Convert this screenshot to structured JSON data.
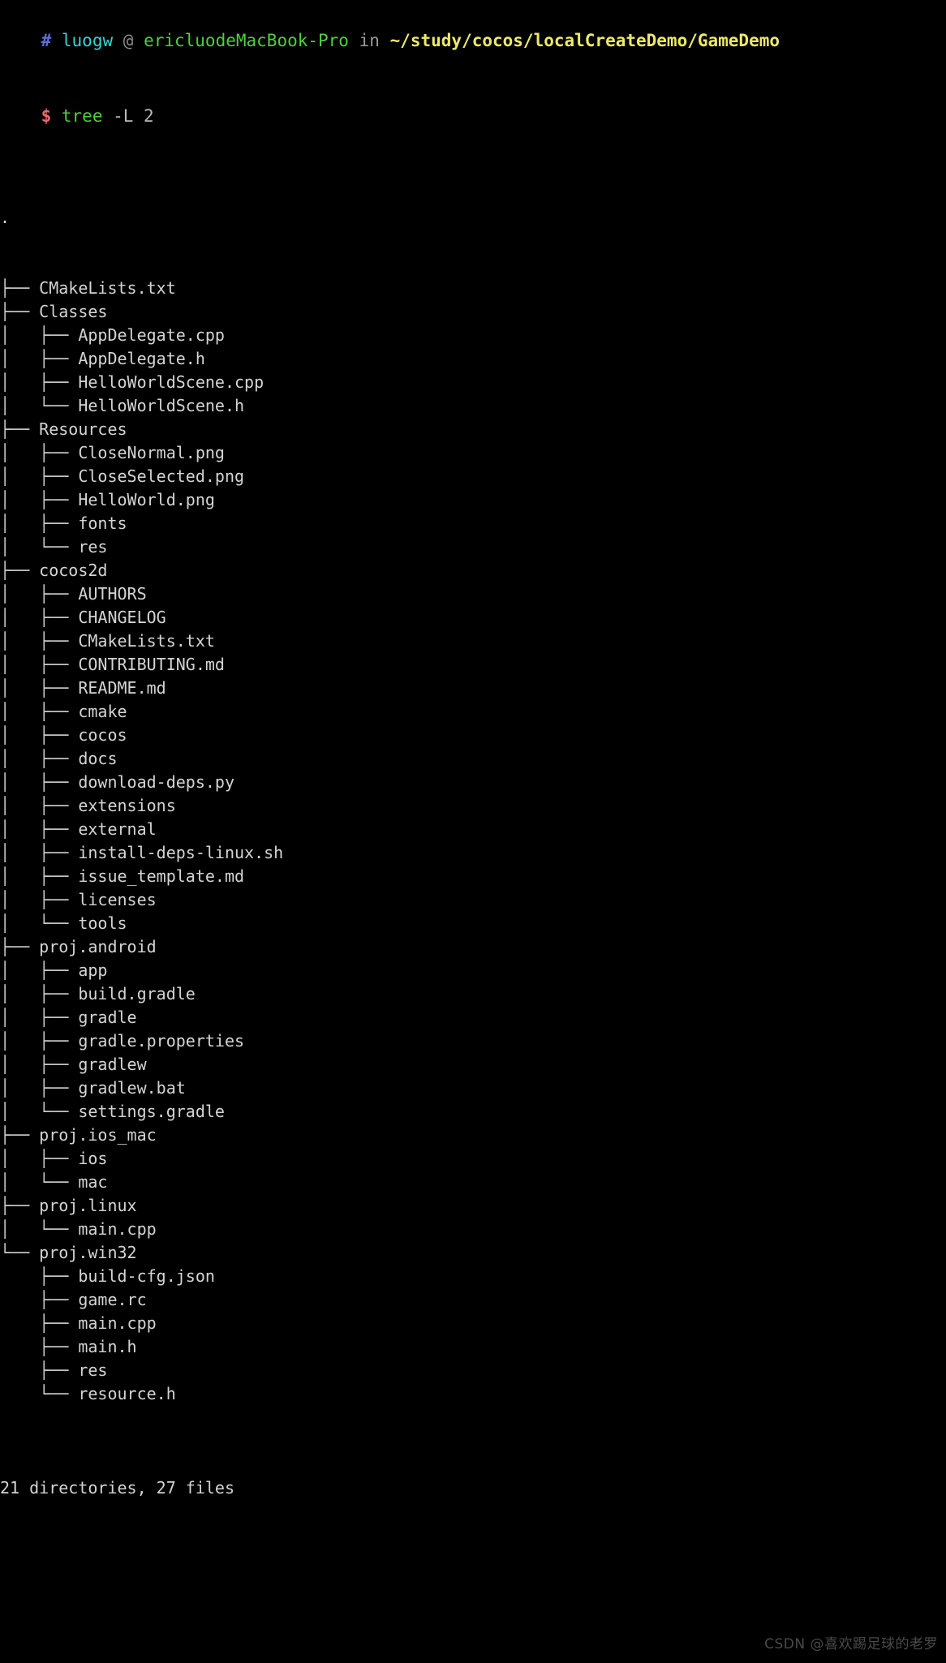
{
  "terminal": {
    "prompt": {
      "marker": "#",
      "user": "luogw",
      "at": "@",
      "host": "ericluodeMacBook-Pro",
      "in_word": "in",
      "path": "~/study/cocos/localCreateDemo/GameDemo"
    },
    "command_line": {
      "symbol": "$",
      "command": "tree",
      "args": "-L 2"
    },
    "root": ".",
    "tree": [
      {
        "branch": "├── ",
        "name": "CMakeLists.txt"
      },
      {
        "branch": "├── ",
        "name": "Classes"
      },
      {
        "branch": "│   ├── ",
        "name": "AppDelegate.cpp"
      },
      {
        "branch": "│   ├── ",
        "name": "AppDelegate.h"
      },
      {
        "branch": "│   ├── ",
        "name": "HelloWorldScene.cpp"
      },
      {
        "branch": "│   └── ",
        "name": "HelloWorldScene.h"
      },
      {
        "branch": "├── ",
        "name": "Resources"
      },
      {
        "branch": "│   ├── ",
        "name": "CloseNormal.png"
      },
      {
        "branch": "│   ├── ",
        "name": "CloseSelected.png"
      },
      {
        "branch": "│   ├── ",
        "name": "HelloWorld.png"
      },
      {
        "branch": "│   ├── ",
        "name": "fonts"
      },
      {
        "branch": "│   └── ",
        "name": "res"
      },
      {
        "branch": "├── ",
        "name": "cocos2d"
      },
      {
        "branch": "│   ├── ",
        "name": "AUTHORS"
      },
      {
        "branch": "│   ├── ",
        "name": "CHANGELOG"
      },
      {
        "branch": "│   ├── ",
        "name": "CMakeLists.txt"
      },
      {
        "branch": "│   ├── ",
        "name": "CONTRIBUTING.md"
      },
      {
        "branch": "│   ├── ",
        "name": "README.md"
      },
      {
        "branch": "│   ├── ",
        "name": "cmake"
      },
      {
        "branch": "│   ├── ",
        "name": "cocos"
      },
      {
        "branch": "│   ├── ",
        "name": "docs"
      },
      {
        "branch": "│   ├── ",
        "name": "download-deps.py"
      },
      {
        "branch": "│   ├── ",
        "name": "extensions"
      },
      {
        "branch": "│   ├── ",
        "name": "external"
      },
      {
        "branch": "│   ├── ",
        "name": "install-deps-linux.sh"
      },
      {
        "branch": "│   ├── ",
        "name": "issue_template.md"
      },
      {
        "branch": "│   ├── ",
        "name": "licenses"
      },
      {
        "branch": "│   └── ",
        "name": "tools"
      },
      {
        "branch": "├── ",
        "name": "proj.android"
      },
      {
        "branch": "│   ├── ",
        "name": "app"
      },
      {
        "branch": "│   ├── ",
        "name": "build.gradle"
      },
      {
        "branch": "│   ├── ",
        "name": "gradle"
      },
      {
        "branch": "│   ├── ",
        "name": "gradle.properties"
      },
      {
        "branch": "│   ├── ",
        "name": "gradlew"
      },
      {
        "branch": "│   ├── ",
        "name": "gradlew.bat"
      },
      {
        "branch": "│   └── ",
        "name": "settings.gradle"
      },
      {
        "branch": "├── ",
        "name": "proj.ios_mac"
      },
      {
        "branch": "│   ├── ",
        "name": "ios"
      },
      {
        "branch": "│   └── ",
        "name": "mac"
      },
      {
        "branch": "├── ",
        "name": "proj.linux"
      },
      {
        "branch": "│   └── ",
        "name": "main.cpp"
      },
      {
        "branch": "└── ",
        "name": "proj.win32"
      },
      {
        "branch": "    ├── ",
        "name": "build-cfg.json"
      },
      {
        "branch": "    ├── ",
        "name": "game.rc"
      },
      {
        "branch": "    ├── ",
        "name": "main.cpp"
      },
      {
        "branch": "    ├── ",
        "name": "main.h"
      },
      {
        "branch": "    ├── ",
        "name": "res"
      },
      {
        "branch": "    └── ",
        "name": "resource.h"
      }
    ],
    "summary": "21 directories, 27 files",
    "watermark": "CSDN @喜欢踢足球的老罗"
  }
}
